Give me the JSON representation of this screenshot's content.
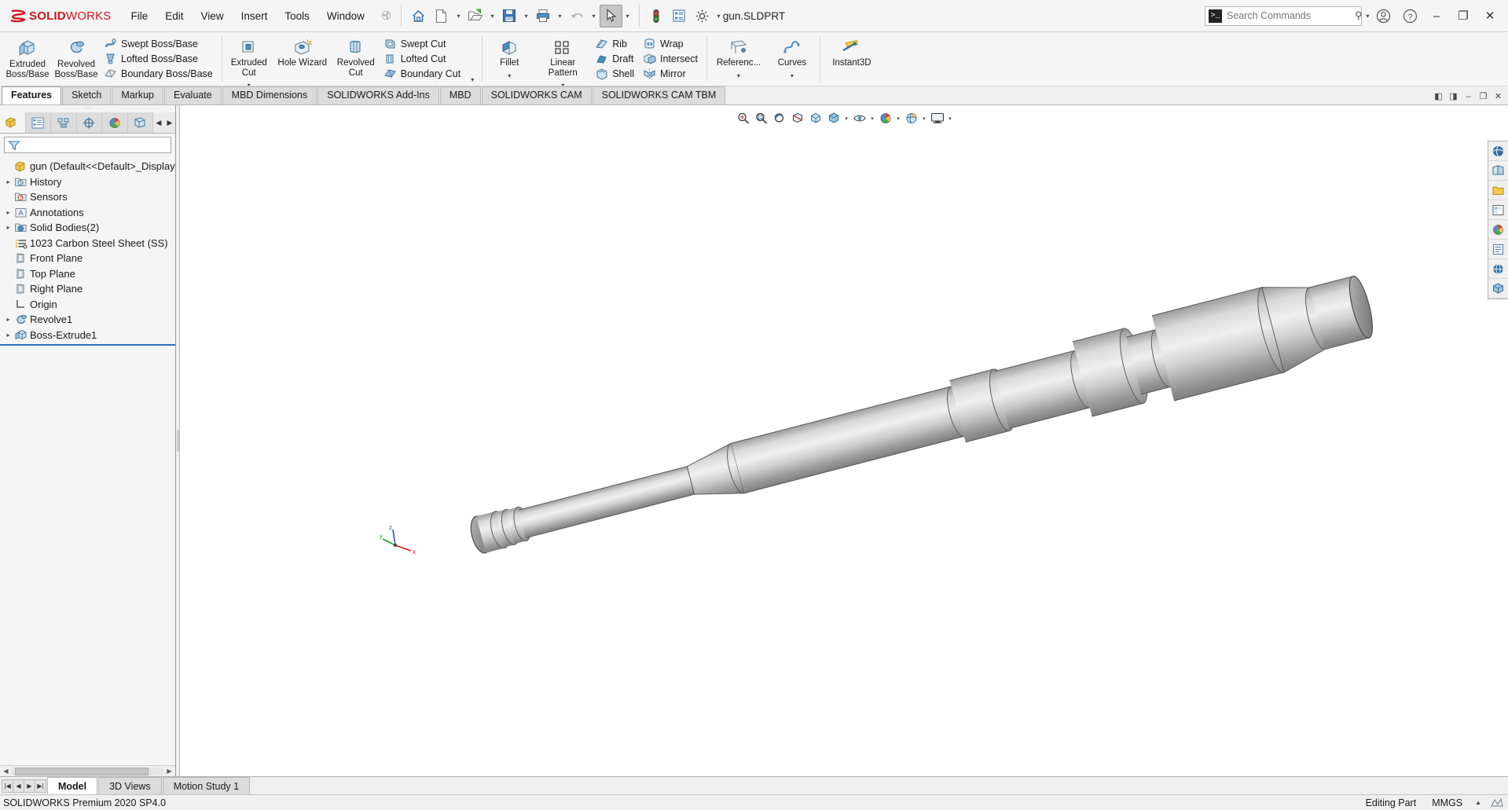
{
  "app": {
    "brand_ds": "3DS",
    "brand_solid": "SOLID",
    "brand_works": "WORKS",
    "document_title": "gun.SLDPRT",
    "accent_red": "#d31317",
    "accent_blue": "#4a90c4"
  },
  "menubar": {
    "items": [
      {
        "label": "File"
      },
      {
        "label": "Edit"
      },
      {
        "label": "View"
      },
      {
        "label": "Insert"
      },
      {
        "label": "Tools"
      },
      {
        "label": "Window"
      }
    ],
    "pin_icon": "pushpin-icon"
  },
  "quick_access": {
    "buttons": [
      {
        "name": "home-icon",
        "label": "Home"
      },
      {
        "name": "new-document-icon",
        "label": "New"
      },
      {
        "name": "open-folder-icon",
        "label": "Open"
      },
      {
        "name": "save-icon",
        "label": "Save"
      },
      {
        "name": "print-icon",
        "label": "Print"
      },
      {
        "name": "undo-icon",
        "label": "Undo"
      },
      {
        "name": "select-cursor-icon",
        "label": "Select"
      },
      {
        "name": "rebuild-traffic-light-icon",
        "label": "Rebuild"
      },
      {
        "name": "file-properties-icon",
        "label": "File Properties"
      },
      {
        "name": "options-gear-icon",
        "label": "Options"
      }
    ]
  },
  "search": {
    "placeholder": "Search Commands",
    "command_icon": "command-prompt-icon",
    "magnifier_icon": "search-icon"
  },
  "window_controls": {
    "account_icon": "user-account-icon",
    "help_icon": "help-question-icon",
    "minimize": "–",
    "restore": "❐",
    "close": "✕"
  },
  "ribbon": {
    "groups": [
      {
        "name": "boss-base-group",
        "big": [
          {
            "label": "Extruded\nBoss/Base",
            "icon": "extruded-boss-icon",
            "caret": false
          },
          {
            "label": "Revolved\nBoss/Base",
            "icon": "revolved-boss-icon",
            "caret": false
          }
        ],
        "small": [
          {
            "label": "Swept Boss/Base",
            "icon": "swept-boss-icon"
          },
          {
            "label": "Lofted Boss/Base",
            "icon": "lofted-boss-icon"
          },
          {
            "label": "Boundary Boss/Base",
            "icon": "boundary-boss-icon"
          }
        ]
      },
      {
        "name": "cut-group",
        "big": [
          {
            "label": "Extruded\nCut",
            "icon": "extruded-cut-icon",
            "caret": true
          },
          {
            "label": "Hole Wizard",
            "icon": "hole-wizard-icon",
            "caret": false
          },
          {
            "label": "Revolved\nCut",
            "icon": "revolved-cut-icon",
            "caret": false
          }
        ],
        "small": [
          {
            "label": "Swept Cut",
            "icon": "swept-cut-icon"
          },
          {
            "label": "Lofted Cut",
            "icon": "lofted-cut-icon"
          },
          {
            "label": "Boundary Cut",
            "icon": "boundary-cut-icon"
          }
        ]
      },
      {
        "name": "feature-group",
        "big": [
          {
            "label": "Fillet",
            "icon": "fillet-icon",
            "caret": true
          },
          {
            "label": "Linear Pattern",
            "icon": "linear-pattern-icon",
            "caret": true
          }
        ],
        "small": [
          {
            "label": "Rib",
            "icon": "rib-icon"
          },
          {
            "label": "Draft",
            "icon": "draft-icon"
          },
          {
            "label": "Shell",
            "icon": "shell-icon"
          }
        ],
        "small2": [
          {
            "label": "Wrap",
            "icon": "wrap-icon"
          },
          {
            "label": "Intersect",
            "icon": "intersect-icon"
          },
          {
            "label": "Mirror",
            "icon": "mirror-icon"
          }
        ]
      },
      {
        "name": "reference-group",
        "big": [
          {
            "label": "Referenc...",
            "icon": "reference-geometry-icon",
            "caret": true
          },
          {
            "label": "Curves",
            "icon": "curves-icon",
            "caret": true
          }
        ]
      },
      {
        "name": "instant3d-group",
        "big": [
          {
            "label": "Instant3D",
            "icon": "instant3d-icon",
            "caret": false
          }
        ]
      }
    ]
  },
  "command_tabs": {
    "items": [
      {
        "label": "Features",
        "active": true
      },
      {
        "label": "Sketch",
        "active": false
      },
      {
        "label": "Markup",
        "active": false
      },
      {
        "label": "Evaluate",
        "active": false
      },
      {
        "label": "MBD Dimensions",
        "active": false
      },
      {
        "label": "SOLIDWORKS Add-Ins",
        "active": false
      },
      {
        "label": "MBD",
        "active": false
      },
      {
        "label": "SOLIDWORKS CAM",
        "active": false
      },
      {
        "label": "SOLIDWORKS CAM TBM",
        "active": false
      }
    ],
    "window_buttons": [
      {
        "name": "restore-panel-left-icon",
        "glyph": "◧"
      },
      {
        "name": "restore-panel-right-icon",
        "glyph": "◨"
      },
      {
        "name": "minimize-doc-icon",
        "glyph": "–"
      },
      {
        "name": "restore-doc-icon",
        "glyph": "❐"
      },
      {
        "name": "close-doc-icon",
        "glyph": "✕"
      }
    ]
  },
  "feature_manager": {
    "tabs": [
      {
        "name": "feature-tree-tab",
        "icon": "feature-tree-icon",
        "active": true
      },
      {
        "name": "property-manager-tab",
        "icon": "property-manager-icon",
        "active": false
      },
      {
        "name": "configuration-manager-tab",
        "icon": "configuration-manager-icon",
        "active": false
      },
      {
        "name": "dimxpert-manager-tab",
        "icon": "dimxpert-icon",
        "active": false
      },
      {
        "name": "display-manager-tab",
        "icon": "display-manager-icon",
        "active": false
      },
      {
        "name": "cam-feature-tree-tab",
        "icon": "cam-tree-icon",
        "active": false
      }
    ],
    "filter": {
      "placeholder": "",
      "value": "",
      "icon": "filter-funnel-icon"
    },
    "root": {
      "label": "gun  (Default<<Default>_Display Sta",
      "icon": "part-document-icon"
    },
    "items": [
      {
        "label": "History",
        "icon": "history-folder-icon",
        "expandable": true,
        "indent": 1
      },
      {
        "label": "Sensors",
        "icon": "sensors-folder-icon",
        "expandable": false,
        "indent": 1
      },
      {
        "label": "Annotations",
        "icon": "annotations-folder-icon",
        "expandable": true,
        "indent": 1
      },
      {
        "label": "Solid Bodies(2)",
        "icon": "solid-bodies-folder-icon",
        "expandable": true,
        "indent": 1
      },
      {
        "label": "1023 Carbon Steel Sheet (SS)",
        "icon": "material-icon",
        "expandable": false,
        "indent": 1
      },
      {
        "label": "Front Plane",
        "icon": "plane-icon",
        "expandable": false,
        "indent": 1
      },
      {
        "label": "Top Plane",
        "icon": "plane-icon",
        "expandable": false,
        "indent": 1
      },
      {
        "label": "Right Plane",
        "icon": "plane-icon",
        "expandable": false,
        "indent": 1
      },
      {
        "label": "Origin",
        "icon": "origin-icon",
        "expandable": false,
        "indent": 1
      },
      {
        "label": "Revolve1",
        "icon": "revolve-feature-icon",
        "expandable": true,
        "indent": 1
      },
      {
        "label": "Boss-Extrude1",
        "icon": "boss-extrude-feature-icon",
        "expandable": true,
        "indent": 1
      }
    ],
    "rollback_bar": true
  },
  "view_toolbar": {
    "buttons": [
      {
        "name": "zoom-to-fit-icon",
        "label": "Zoom to Fit"
      },
      {
        "name": "zoom-to-area-icon",
        "label": "Zoom to Area"
      },
      {
        "name": "previous-view-icon",
        "label": "Previous View"
      },
      {
        "name": "section-view-icon",
        "label": "Section View"
      },
      {
        "name": "view-orientation-icon",
        "label": "View Orientation"
      },
      {
        "name": "display-style-icon",
        "label": "Display Style",
        "caret": true
      },
      {
        "name": "hide-show-items-icon",
        "label": "Hide/Show Items",
        "caret": true
      },
      {
        "name": "edit-appearance-icon",
        "label": "Edit Appearance",
        "caret": true
      },
      {
        "name": "apply-scene-icon",
        "label": "Apply Scene",
        "caret": true
      },
      {
        "name": "view-settings-icon",
        "label": "View Settings",
        "caret": true
      }
    ]
  },
  "task_pane": {
    "buttons": [
      {
        "name": "solidworks-resources-icon",
        "label": "SOLIDWORKS Resources"
      },
      {
        "name": "design-library-icon",
        "label": "Design Library"
      },
      {
        "name": "file-explorer-icon",
        "label": "File Explorer"
      },
      {
        "name": "view-palette-icon",
        "label": "View Palette"
      },
      {
        "name": "appearances-scenes-icon",
        "label": "Appearances, Scenes and Decals"
      },
      {
        "name": "custom-properties-icon",
        "label": "Custom Properties"
      },
      {
        "name": "solidworks-forum-icon",
        "label": "SOLIDWORKS Forum"
      },
      {
        "name": "cam-task-pane-icon",
        "label": "SOLIDWORKS CAM"
      }
    ]
  },
  "triad": {
    "x_label": "x",
    "y_label": "y",
    "z_label": "z",
    "x_color": "#d01c1c",
    "y_color": "#1f9e1f",
    "z_color": "#2a4fd0"
  },
  "bottom_tabs": {
    "nav_buttons": [
      {
        "name": "first-tab-button",
        "glyph": "|◀"
      },
      {
        "name": "prev-tab-button",
        "glyph": "◀"
      },
      {
        "name": "next-tab-button",
        "glyph": "▶"
      },
      {
        "name": "last-tab-button",
        "glyph": "▶|"
      }
    ],
    "items": [
      {
        "label": "Model",
        "active": true
      },
      {
        "label": "3D Views",
        "active": false
      },
      {
        "label": "Motion Study 1",
        "active": false
      }
    ]
  },
  "status_bar": {
    "left": "SOLIDWORKS Premium 2020 SP4.0",
    "edit_mode": "Editing Part",
    "units": "MMGS",
    "units_caret": "▲",
    "overlay_icon": "tessellation-icon"
  },
  "model": {
    "name": "gun-barrel-shaft",
    "description": "Shaded stepped cylindrical shaft / gun barrel body",
    "face_light": "#e8e8e8",
    "face_mid": "#b9b9b9",
    "face_dark": "#8e8e8e",
    "edge_color": "#4a4a4a"
  }
}
